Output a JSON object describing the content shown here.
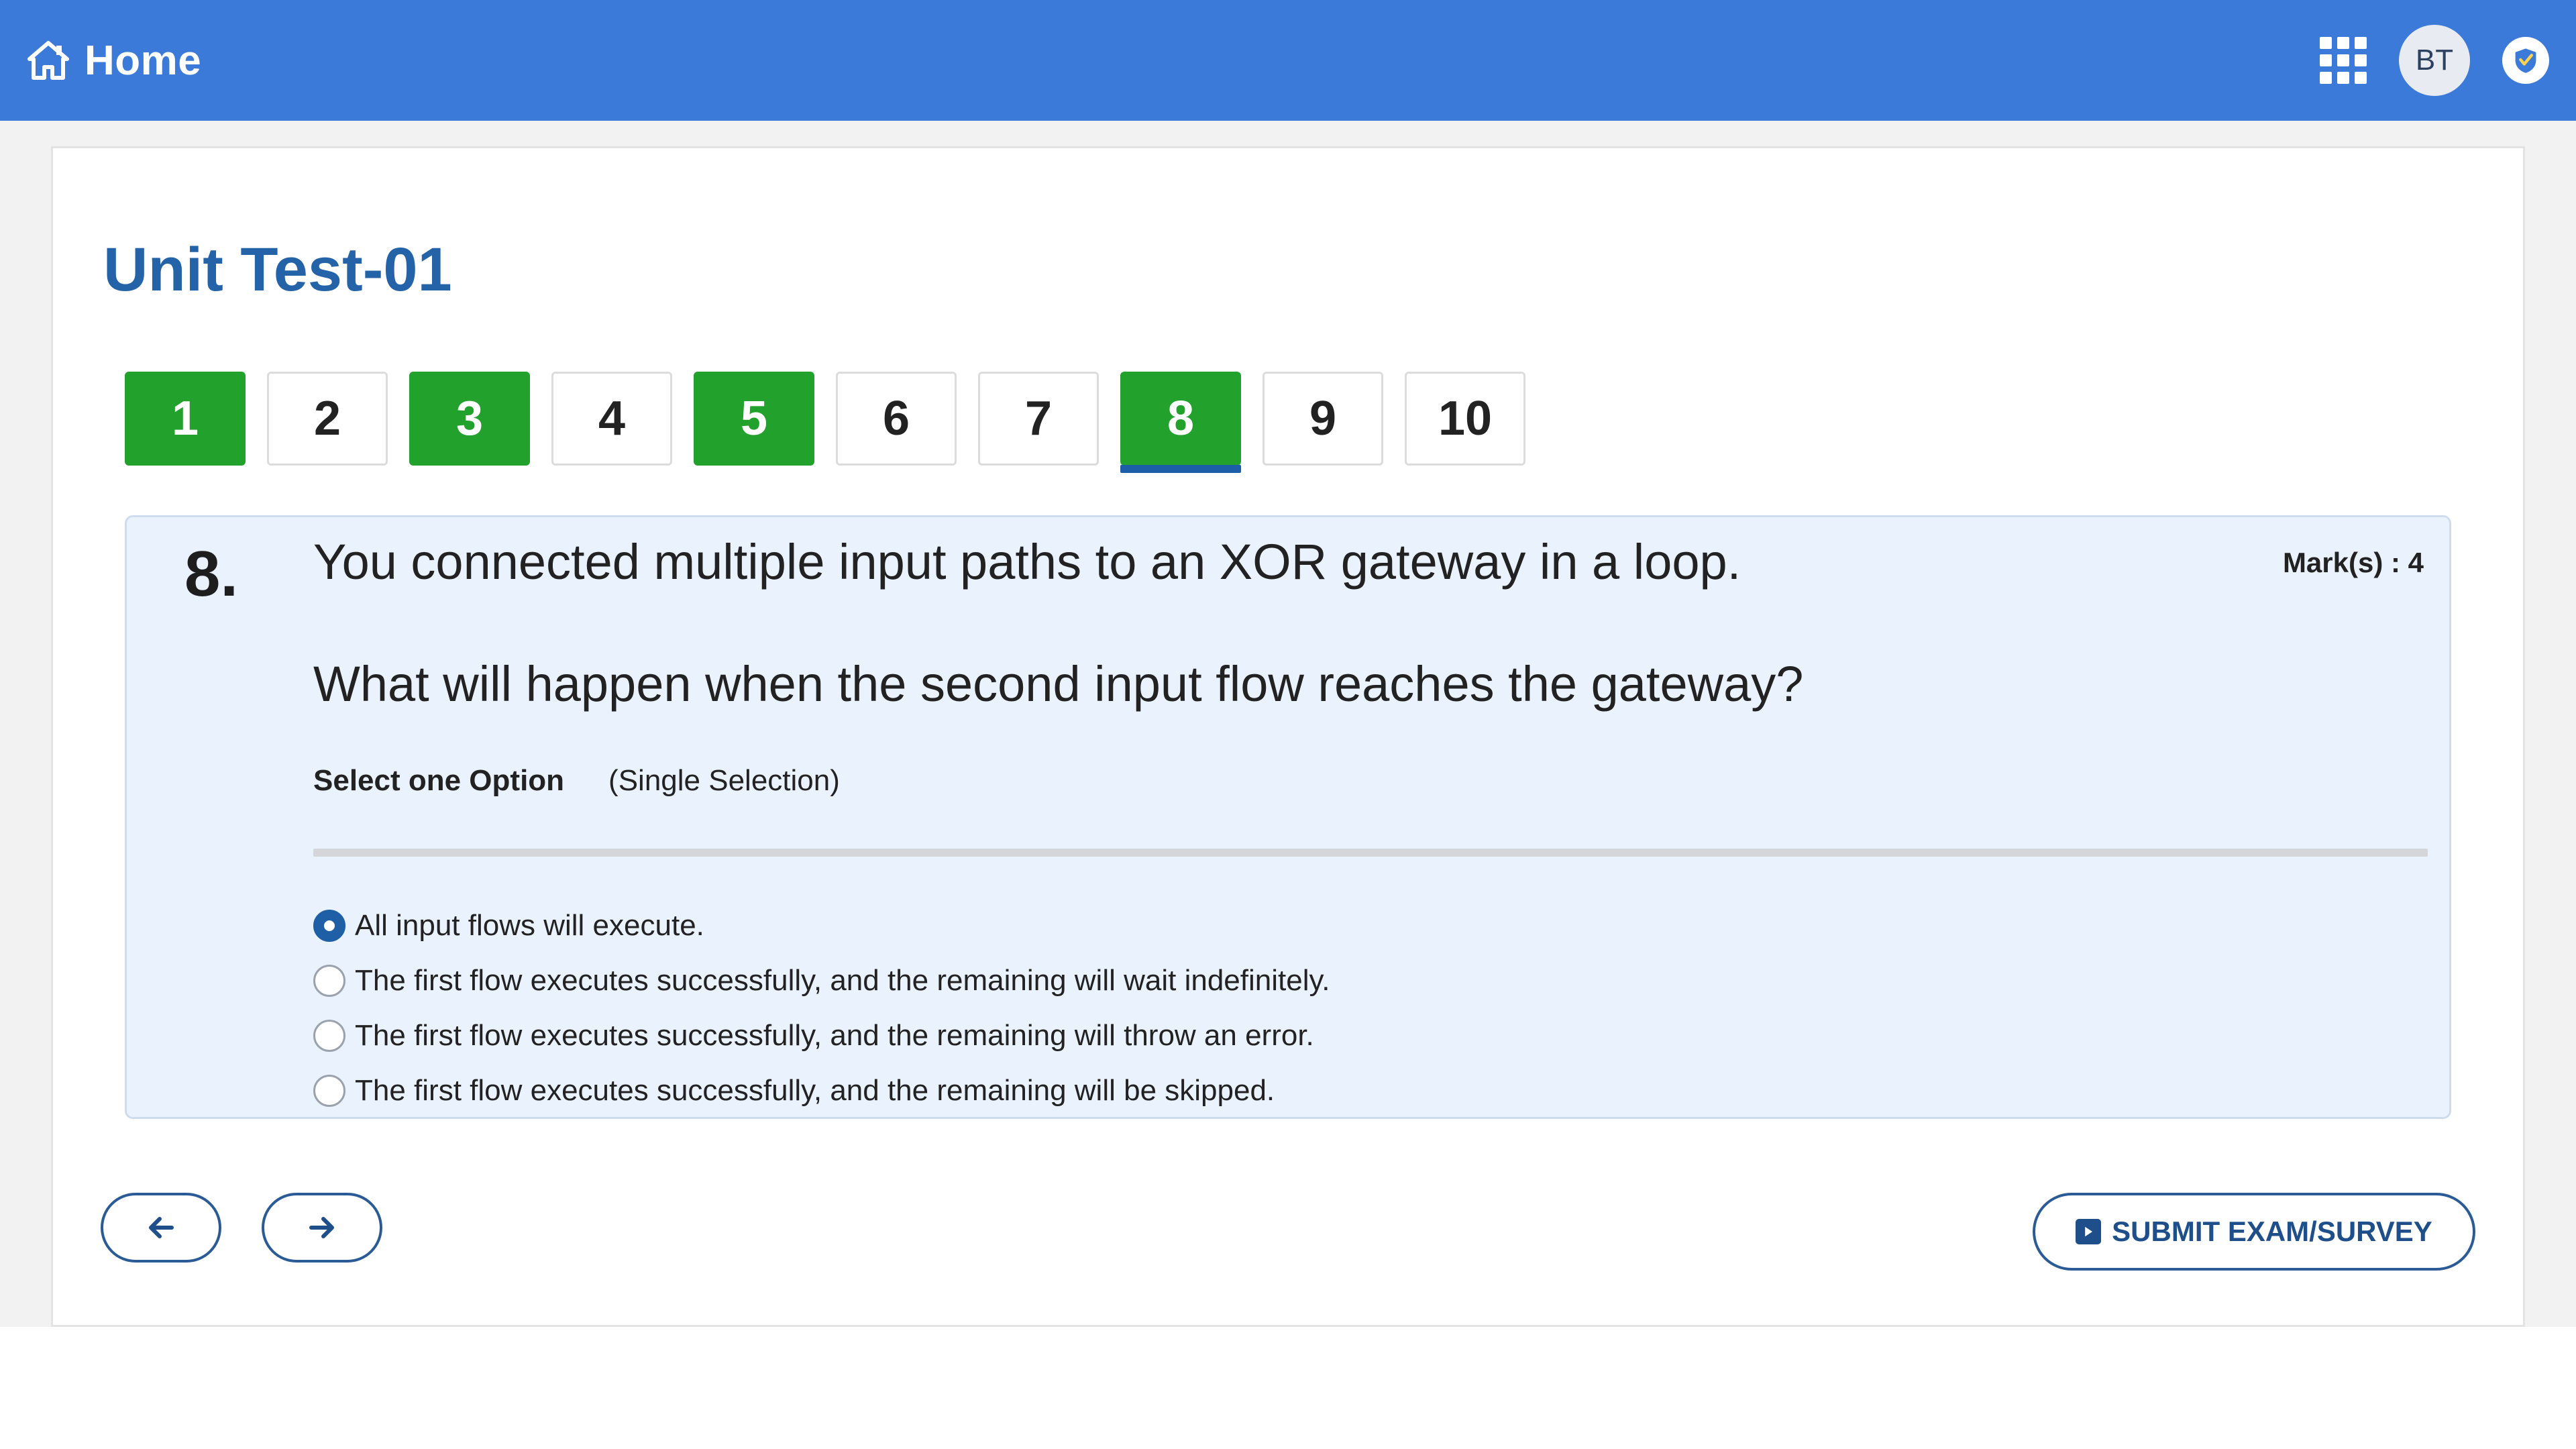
{
  "header": {
    "home_label": "Home",
    "avatar_initials": "BT",
    "colors": {
      "bar": "#3c7ad9"
    }
  },
  "exam": {
    "title": "Unit Test-01",
    "questions": [
      {
        "label": "1",
        "state": "answered"
      },
      {
        "label": "2",
        "state": "unanswered"
      },
      {
        "label": "3",
        "state": "answered"
      },
      {
        "label": "4",
        "state": "unanswered"
      },
      {
        "label": "5",
        "state": "answered"
      },
      {
        "label": "6",
        "state": "unanswered"
      },
      {
        "label": "7",
        "state": "unanswered"
      },
      {
        "label": "8",
        "state": "answered-current"
      },
      {
        "label": "9",
        "state": "unanswered"
      },
      {
        "label": "10",
        "state": "unanswered"
      }
    ]
  },
  "question": {
    "number": "8.",
    "text_line1": "You connected multiple input paths to an XOR gateway in a loop.",
    "text_line2": "What will happen when the second input flow reaches the gateway?",
    "marks": "Mark(s) :  4",
    "select_label": "Select one Option",
    "selection_type": "(Single Selection)",
    "options": [
      {
        "label": "All input flows will execute.",
        "selected": true
      },
      {
        "label": "The first flow executes successfully, and the remaining will wait indefinitely.",
        "selected": false
      },
      {
        "label": "The first flow executes successfully, and the remaining will throw an error.",
        "selected": false
      },
      {
        "label": "The first flow executes successfully, and the remaining will be skipped.",
        "selected": false
      }
    ]
  },
  "footer": {
    "prev_icon": "arrow-left-icon",
    "next_icon": "arrow-right-icon",
    "submit_label": "SUBMIT EXAM/SURVEY"
  }
}
